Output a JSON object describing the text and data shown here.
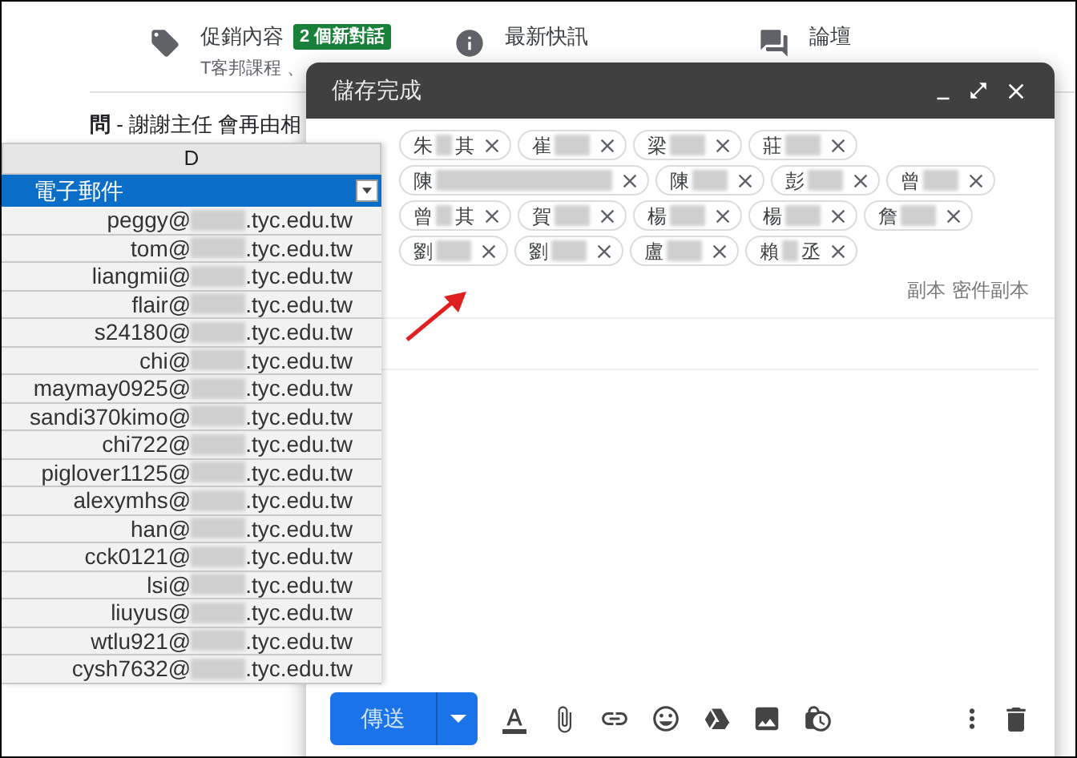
{
  "background": {
    "categories": [
      {
        "kind": "promo",
        "title": "促銷內容",
        "badge": "2 個新對話",
        "subtitle": "T客邦課程 、"
      },
      {
        "kind": "updates",
        "title": "最新快訊"
      },
      {
        "kind": "forums",
        "title": "論壇"
      }
    ],
    "snippet": "**問** - 謝謝主任 會再由相"
  },
  "sheet": {
    "column_letter": "D",
    "header": "電子郵件",
    "rows": [
      {
        "local": "peggy@",
        "domain": ".tyc.edu.tw"
      },
      {
        "local": "tom@",
        "domain": ".tyc.edu.tw"
      },
      {
        "local": "liangmii@",
        "domain": ".tyc.edu.tw"
      },
      {
        "local": "flair@",
        "domain": ".tyc.edu.tw"
      },
      {
        "local": "s24180@",
        "domain": ".tyc.edu.tw"
      },
      {
        "local": "chi@",
        "domain": ".tyc.edu.tw"
      },
      {
        "local": "maymay0925@",
        "domain": ".tyc.edu.tw"
      },
      {
        "local": "sandi370kimo@",
        "domain": ".tyc.edu.tw"
      },
      {
        "local": "chi722@",
        "domain": ".tyc.edu.tw"
      },
      {
        "local": "piglover1125@",
        "domain": ".tyc.edu.tw"
      },
      {
        "local": "alexymhs@",
        "domain": ".tyc.edu.tw"
      },
      {
        "local": "han@",
        "domain": ".tyc.edu.tw"
      },
      {
        "local": "cck0121@",
        "domain": ".tyc.edu.tw"
      },
      {
        "local": "lsi@",
        "domain": ".tyc.edu.tw"
      },
      {
        "local": "liuyus@",
        "domain": ".tyc.edu.tw"
      },
      {
        "local": "wtlu921@",
        "domain": ".tyc.edu.tw"
      },
      {
        "local": "cysh7632@",
        "domain": ".tyc.edu.tw"
      }
    ]
  },
  "compose": {
    "title": "儲存完成",
    "recipient_rows": [
      {
        "chips": [
          {
            "first": "朱",
            "last": "其",
            "kind": "short"
          },
          {
            "first": "崔",
            "kind": "short"
          },
          {
            "first": "梁",
            "kind": "short"
          },
          {
            "first": "莊",
            "kind": "short"
          }
        ]
      },
      {
        "chips": [
          {
            "first": "陳",
            "kind": "long"
          },
          {
            "first": "陳",
            "kind": "short"
          },
          {
            "first": "彭",
            "kind": "short"
          },
          {
            "first": "曾",
            "kind": "short"
          }
        ]
      },
      {
        "chips": [
          {
            "first": "曾",
            "last": "其",
            "kind": "short"
          },
          {
            "first": "賀",
            "kind": "short"
          },
          {
            "first": "楊",
            "kind": "short"
          },
          {
            "first": "楊",
            "kind": "short"
          },
          {
            "first": "詹",
            "kind": "short"
          }
        ]
      },
      {
        "chips": [
          {
            "first": "劉",
            "kind": "short"
          },
          {
            "first": "劉",
            "kind": "short"
          },
          {
            "first": "盧",
            "kind": "short"
          },
          {
            "first": "賴",
            "last": "丞",
            "kind": "short"
          }
        ]
      }
    ],
    "cc": "副本",
    "bcc": "密件副本",
    "send": "傳送"
  }
}
